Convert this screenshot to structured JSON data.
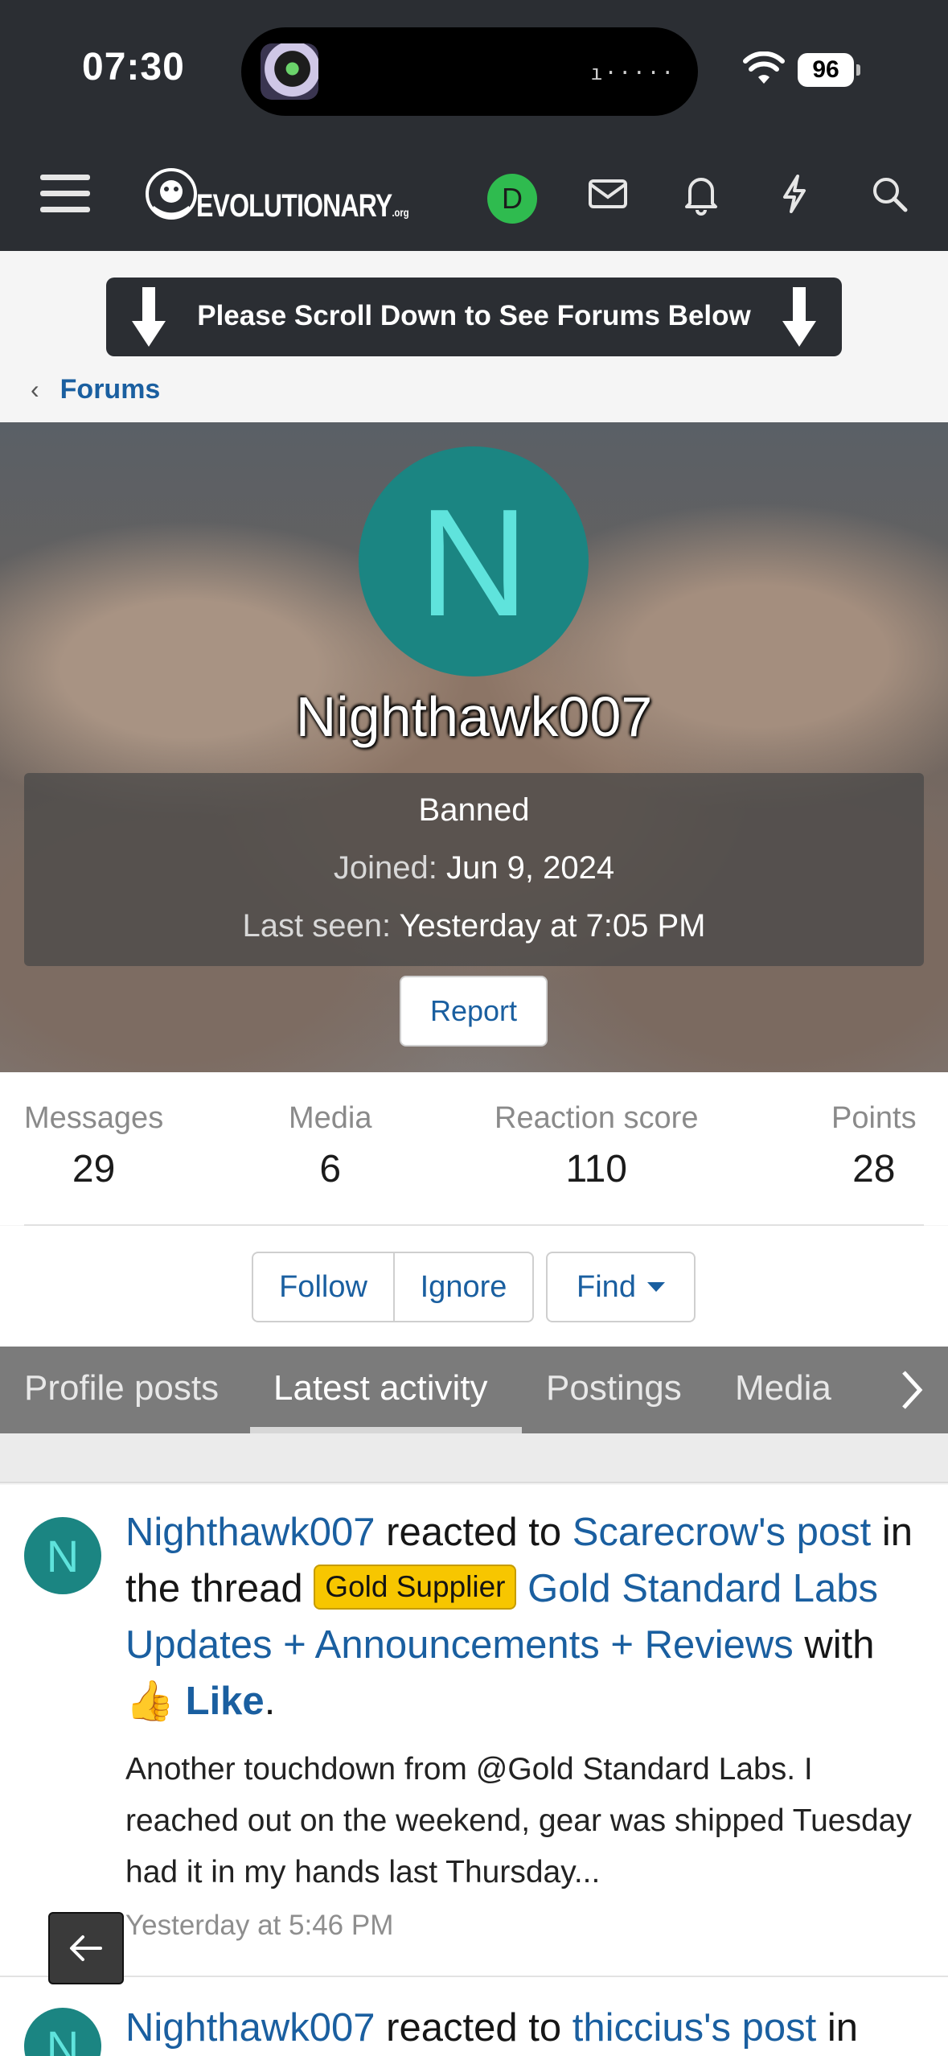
{
  "status_bar": {
    "time": "07:30",
    "battery": "96"
  },
  "header": {
    "logo_text": "EVOLUTIONARY",
    "logo_suffix": ".org",
    "user_initial": "D"
  },
  "banner": {
    "text": "Please Scroll Down to See Forums Below"
  },
  "breadcrumb": {
    "label": "Forums"
  },
  "profile": {
    "initial": "N",
    "username": "Nighthawk007",
    "status": "Banned",
    "joined_label": "Joined:",
    "joined_value": "Jun 9, 2024",
    "last_seen_label": "Last seen:",
    "last_seen_value": "Yesterday at 7:05 PM",
    "report_label": "Report"
  },
  "stats": [
    {
      "label": "Messages",
      "value": "29"
    },
    {
      "label": "Media",
      "value": "6"
    },
    {
      "label": "Reaction score",
      "value": "110"
    },
    {
      "label": "Points",
      "value": "28"
    }
  ],
  "actions": {
    "follow": "Follow",
    "ignore": "Ignore",
    "find": "Find"
  },
  "tabs": [
    {
      "label": "Profile posts",
      "active": false
    },
    {
      "label": "Latest activity",
      "active": true
    },
    {
      "label": "Postings",
      "active": false
    },
    {
      "label": "Media",
      "active": false
    }
  ],
  "feed": [
    {
      "initial": "N",
      "user": "Nighthawk007",
      "verb": "reacted to",
      "target": "Scarecrow's post",
      "in_thread": "in the thread",
      "prefix": "Gold Supplier",
      "thread": "Gold Standard Labs Updates + Announcements + Reviews",
      "with": "with",
      "reaction_emoji": "👍",
      "reaction": "Like",
      "snippet": "Another touchdown from @Gold Standard Labs. I reached out on the weekend, gear was shipped Tuesday had it in my hands last Thursday...",
      "time": "Yesterday at 5:46 PM"
    },
    {
      "initial": "N",
      "user": "Nighthawk007",
      "verb": "reacted to",
      "target": "thiccius's post",
      "in_thread": "in"
    }
  ],
  "colors": {
    "header_bg": "#2b2e33",
    "link": "#1a5fa0",
    "avatar_bg": "#1b8582",
    "prefix_bg": "#f7c600",
    "online_badge": "#2fbb4f"
  }
}
